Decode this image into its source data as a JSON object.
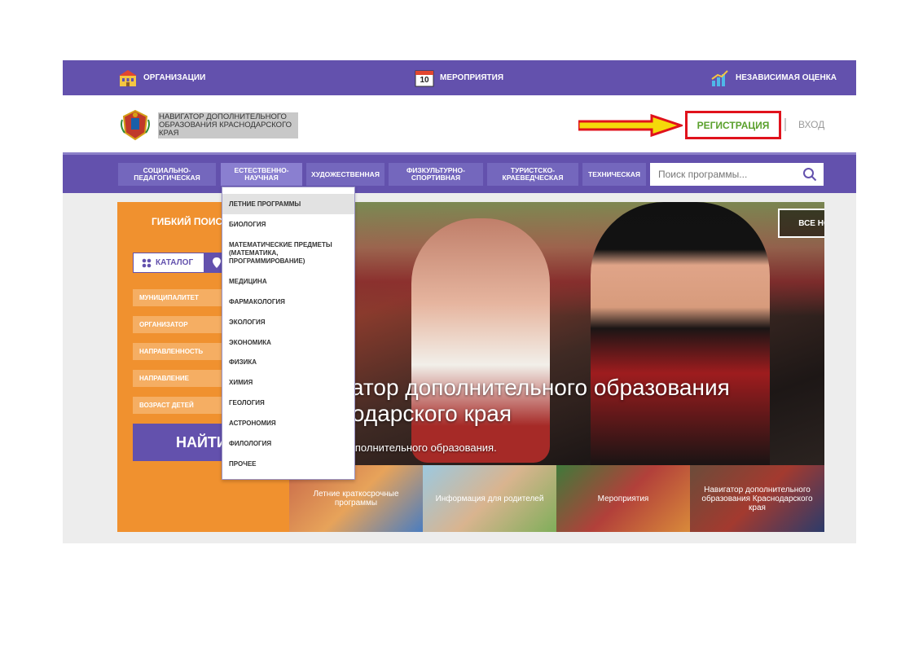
{
  "topbar": {
    "organizations": "ОРГАНИЗАЦИИ",
    "events": "МЕРОПРИЯТИЯ",
    "events_calendar_day": "10",
    "independent_assessment": "НЕЗАВИСИМАЯ ОЦЕНКА"
  },
  "header": {
    "logo_text": "НАВИГАТОР ДОПОЛНИТЕЛЬНОГО ОБРАЗОВАНИЯ КРАСНОДАРСКОГО КРАЯ",
    "register": "РЕГИСТРАЦИЯ",
    "login": "ВХОД"
  },
  "nav": {
    "categories": [
      "СОЦИАЛЬНО-ПЕДАГОГИЧЕСКАЯ",
      "ЕСТЕСТВЕННО-НАУЧНАЯ",
      "ХУДОЖЕСТВЕННАЯ",
      "ФИЗКУЛЬТУРНО-СПОРТИВНАЯ",
      "ТУРИСТСКО-КРАЕВЕДЧЕСКАЯ",
      "ТЕХНИЧЕСКАЯ"
    ],
    "search_placeholder": "Поиск программы..."
  },
  "dropdown": {
    "items": [
      "ЛЕТНИЕ ПРОГРАММЫ",
      "БИОЛОГИЯ",
      "МАТЕМАТИЧЕСКИЕ ПРЕДМЕТЫ (МАТЕМАТИКА, ПРОГРАММИРОВАНИЕ)",
      "МЕДИЦИНА",
      "ФАРМАКОЛОГИЯ",
      "ЭКОЛОГИЯ",
      "ЭКОНОМИКА",
      "ФИЗИКА",
      "ХИМИЯ",
      "ГЕОЛОГИЯ",
      "АСТРОНОМИЯ",
      "ФИЛОЛОГИЯ",
      "ПРОЧЕЕ"
    ]
  },
  "search_panel": {
    "title": "ГИБКИЙ ПОИСК ПРОГРАММ",
    "catalog": "КАТАЛОГ",
    "filters": [
      "МУНИЦИПАЛИТЕТ",
      "ОРГАНИЗАТОР",
      "НАПРАВЛЕННОСТЬ",
      "НАПРАВЛЕНИЕ",
      "ВОЗРАСТ ДЕТЕЙ"
    ],
    "find": "НАЙТИ"
  },
  "hero": {
    "all_news": "ВСЕ НОВОСТИ",
    "title": "Навигатор дополнительного образования Краснодарского края",
    "subtitle": "Навигатор дополнительного образования."
  },
  "tiles": [
    "Летние краткосрочные программы",
    "Информация для родителей",
    "Мероприятия",
    "Навигатор дополнительного образования Краснодарского края"
  ],
  "colors": {
    "brand_purple": "#6351ad",
    "accent_orange": "#f0912f",
    "register_green": "#5aa02c",
    "highlight_red": "#e0121c"
  }
}
